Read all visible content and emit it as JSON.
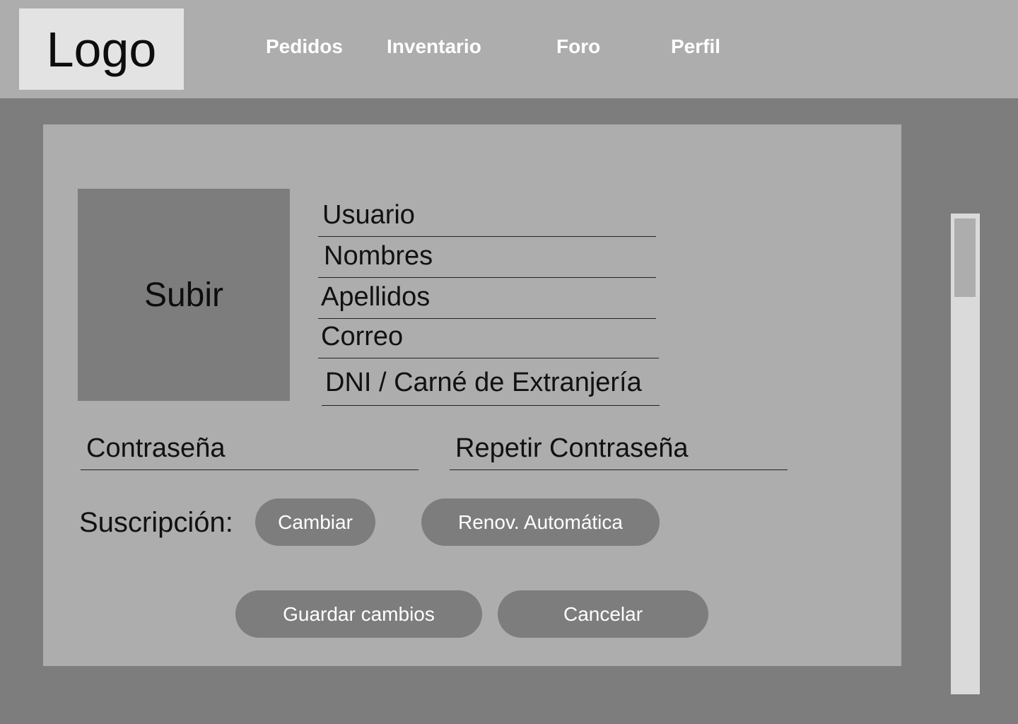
{
  "header": {
    "logo": "Logo",
    "nav": [
      {
        "label": "Pedidos"
      },
      {
        "label": "Inventario"
      },
      {
        "label": "Foro"
      },
      {
        "label": "Perfil"
      }
    ]
  },
  "profile": {
    "upload_label": "Subir",
    "fields": {
      "usuario": "Usuario",
      "nombres": "Nombres",
      "apellidos": "Apellidos",
      "correo": "Correo",
      "dni": "DNI / Carné de Extranjería",
      "password": "Contraseña",
      "repeat_password": "Repetir Contraseña"
    },
    "subscription": {
      "label": "Suscripción:",
      "change_button": "Cambiar",
      "auto_renew_button": "Renov. Automática"
    },
    "actions": {
      "save": "Guardar cambios",
      "cancel": "Cancelar"
    }
  },
  "colors": {
    "header_bg": "#adadad",
    "page_bg": "#7d7d7d",
    "panel_bg": "#adadad",
    "logo_bg": "#e3e3e3",
    "button_bg": "#7d7d7d",
    "scroll_track": "#dadada"
  }
}
